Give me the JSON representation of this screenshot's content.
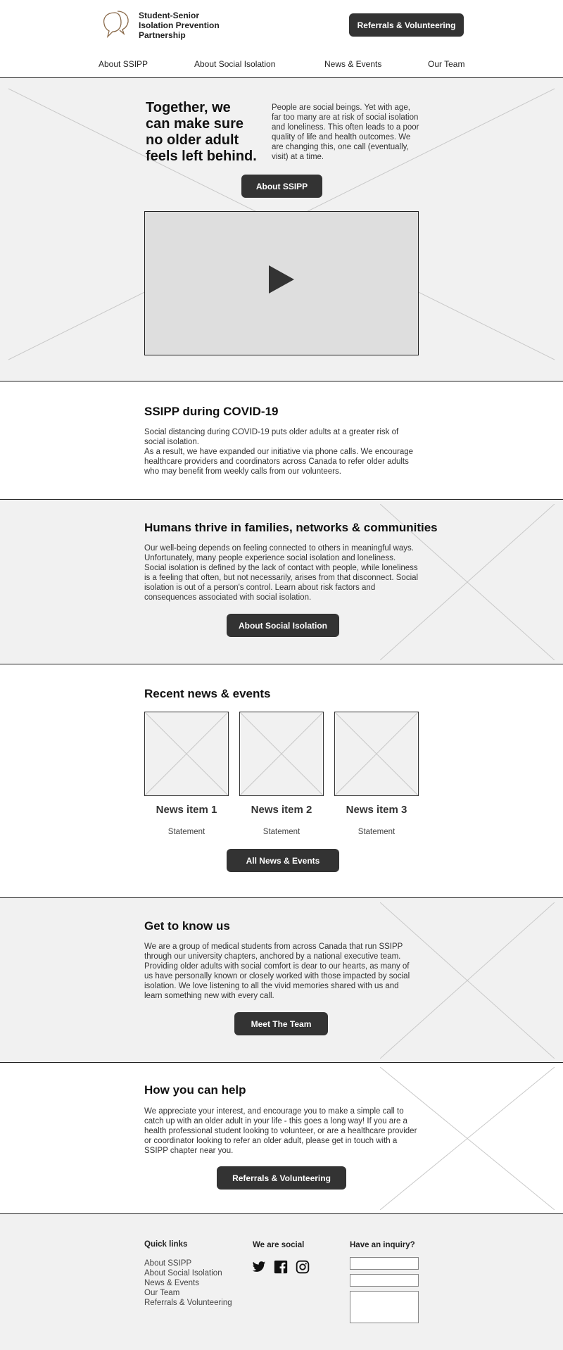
{
  "header": {
    "logo_lines": [
      "Student-Senior",
      "Isolation Prevention",
      "Partnership"
    ],
    "cta_label": "Referrals & Volunteering",
    "nav": [
      "About SSIPP",
      "About Social Isolation",
      "News & Events",
      "Our Team"
    ]
  },
  "hero": {
    "title": "Together, we can make sure no older adult feels left behind.",
    "text": "People are social beings. Yet with age, far too many are at risk of social isolation and loneliness. This often leads to a poor quality of life and health outcomes. We are changing this, one call (eventually, visit) at a time.",
    "button": "About SSIPP",
    "video_icon": "play-icon"
  },
  "covid": {
    "title": "SSIPP during COVID-19",
    "para1": "Social distancing during COVID-19 puts older adults at a greater risk of social isolation.",
    "para2": "As a result, we have expanded our initiative via phone calls. We encourage healthcare providers and coordinators across Canada to refer older adults who may benefit from weekly calls from our volunteers."
  },
  "humans": {
    "title": "Humans thrive in families, networks & communities",
    "text": "Our well-being depends on feeling connected to others in meaningful ways. Unfortunately, many people experience social isolation and loneliness. Social isolation is defined by the lack of contact with people, while loneliness is a feeling that often, but not necessarily, arises from that disconnect. Social isolation is out of a person's control. Learn about risk factors and consequences associated with social isolation.",
    "button": "About Social Isolation"
  },
  "news": {
    "title": "Recent news & events",
    "items": [
      {
        "title": "News item 1",
        "statement": "Statement"
      },
      {
        "title": "News item 2",
        "statement": "Statement"
      },
      {
        "title": "News item 3",
        "statement": "Statement"
      }
    ],
    "button": "All News & Events"
  },
  "know": {
    "title": "Get to know us",
    "text": "We are a group of medical students from across Canada that run SSIPP through our university chapters, anchored by a national executive team. Providing older adults with social comfort is dear to our hearts, as many of us have personally known or closely worked with those impacted by social isolation. We love listening to all the vivid memories shared with us and learn something new with every call.",
    "button": "Meet The Team"
  },
  "help": {
    "title": "How you can help",
    "text": "We appreciate your interest, and encourage you to make a simple call to catch up with an older adult in your life - this goes a long way! If you are a health professional student looking to volunteer, or are a healthcare provider or coordinator looking to refer an older adult, please get in touch with a SSIPP chapter near you.",
    "button": "Referrals & Volunteering"
  },
  "footer": {
    "quick_links_title": "Quick links",
    "links": [
      "About SSIPP",
      "About Social Isolation",
      "News & Events",
      "Our Team",
      "Referrals & Volunteering"
    ],
    "social_title": "We are social",
    "social_icons": [
      "twitter-icon",
      "facebook-icon",
      "instagram-icon"
    ],
    "inquiry_title": "Have an inquiry?"
  }
}
